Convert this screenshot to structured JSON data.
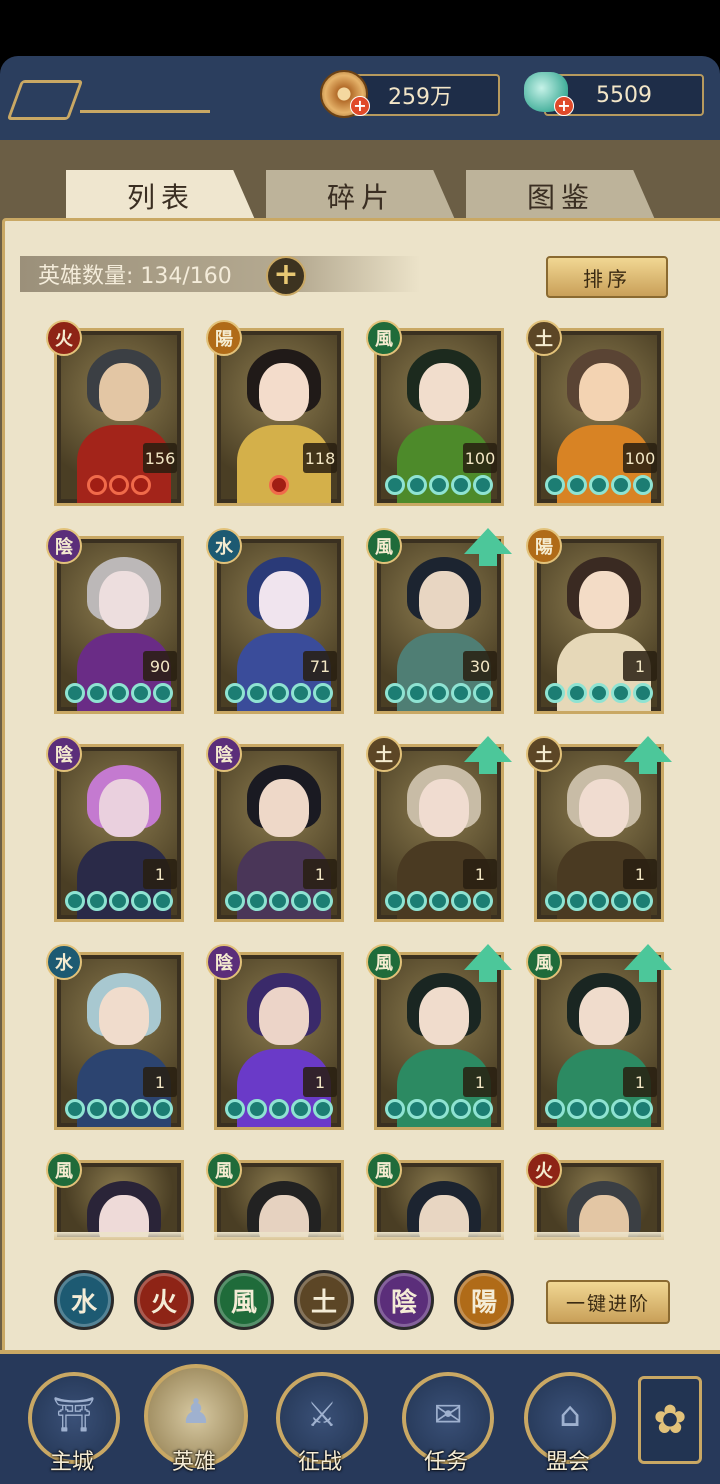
{
  "header": {
    "copper_amount": "259万",
    "jade_amount": "5509",
    "copper_icon": "copper-coin-icon",
    "jade_icon": "jade-pouch-icon"
  },
  "tabs": [
    {
      "label": "列表",
      "active": true
    },
    {
      "label": "碎片",
      "active": false
    },
    {
      "label": "图鉴",
      "active": false
    }
  ],
  "hero_count": "英雄数量: 134/160",
  "sort_label": "排序",
  "elements": {
    "fire": {
      "glyph": "火",
      "color": "#8e2416"
    },
    "yang": {
      "glyph": "陽",
      "color": "#b06b18"
    },
    "wind": {
      "glyph": "風",
      "color": "#1f6b3a"
    },
    "earth": {
      "glyph": "土",
      "color": "#5c4626"
    },
    "yin": {
      "glyph": "陰",
      "color": "#5b2e7a"
    },
    "water": {
      "glyph": "水",
      "color": "#1d5a72"
    }
  },
  "heroes": [
    {
      "element": "fire",
      "level": "156",
      "stars": 3,
      "star_color": "red",
      "upgrade": false,
      "art": [
        "#e3c6a4",
        "#3b3f44",
        "#a3241a"
      ]
    },
    {
      "element": "yang",
      "level": "118",
      "stars": 1,
      "star_color": "red",
      "upgrade": false,
      "art": [
        "#f3dccb",
        "#201a18",
        "#d4b04a"
      ]
    },
    {
      "element": "wind",
      "level": "100",
      "stars": 5,
      "star_color": "teal",
      "upgrade": false,
      "art": [
        "#f1ddcc",
        "#1c2a1e",
        "#4d8a2a"
      ]
    },
    {
      "element": "earth",
      "level": "100",
      "stars": 5,
      "star_color": "teal",
      "upgrade": false,
      "art": [
        "#f3d3b2",
        "#5a4434",
        "#d88324"
      ]
    },
    {
      "element": "yin",
      "level": "90",
      "stars": 5,
      "star_color": "teal",
      "upgrade": false,
      "art": [
        "#eddede",
        "#bcb8b8",
        "#6a2c86"
      ]
    },
    {
      "element": "water",
      "level": "71",
      "stars": 5,
      "star_color": "teal",
      "upgrade": false,
      "art": [
        "#f0e4ee",
        "#2a3a78",
        "#3a4c9a"
      ]
    },
    {
      "element": "wind",
      "level": "30",
      "stars": 5,
      "star_color": "teal",
      "upgrade": true,
      "art": [
        "#e8d6c2",
        "#1c2430",
        "#4f7e74"
      ]
    },
    {
      "element": "yang",
      "level": "1",
      "stars": 5,
      "star_color": "teal",
      "upgrade": false,
      "art": [
        "#f3dcc6",
        "#3a2a22",
        "#e6d8b8"
      ]
    },
    {
      "element": "yin",
      "level": "1",
      "stars": 5,
      "star_color": "teal",
      "upgrade": false,
      "art": [
        "#ead0de",
        "#c47ad0",
        "#2a2a48"
      ]
    },
    {
      "element": "yin",
      "level": "1",
      "stars": 5,
      "star_color": "teal",
      "upgrade": false,
      "art": [
        "#eed8c8",
        "#1a1a22",
        "#4a3658"
      ]
    },
    {
      "element": "earth",
      "level": "1",
      "stars": 5,
      "star_color": "teal",
      "upgrade": true,
      "art": [
        "#f0dcd0",
        "#c8bca6",
        "#4a3a22"
      ]
    },
    {
      "element": "earth",
      "level": "1",
      "stars": 5,
      "star_color": "teal",
      "upgrade": true,
      "art": [
        "#f0dcd0",
        "#c8bca6",
        "#4a3a22"
      ]
    },
    {
      "element": "water",
      "level": "1",
      "stars": 5,
      "star_color": "teal",
      "upgrade": false,
      "art": [
        "#f0dccc",
        "#a8c8d0",
        "#2c4470"
      ]
    },
    {
      "element": "yin",
      "level": "1",
      "stars": 5,
      "star_color": "teal",
      "upgrade": false,
      "art": [
        "#ecd4c8",
        "#3a2a6a",
        "#6a3ac8"
      ]
    },
    {
      "element": "wind",
      "level": "1",
      "stars": 5,
      "star_color": "teal",
      "upgrade": true,
      "art": [
        "#f0dccc",
        "#1a2622",
        "#2c8a62"
      ]
    },
    {
      "element": "wind",
      "level": "1",
      "stars": 5,
      "star_color": "teal",
      "upgrade": true,
      "art": [
        "#f0dccc",
        "#1a2622",
        "#2c8a62"
      ]
    },
    {
      "element": "wind",
      "level": "",
      "stars": 0,
      "star_color": "teal",
      "upgrade": false,
      "art": [
        "#eedad8",
        "#2a2438",
        "#8ac83c"
      ]
    },
    {
      "element": "wind",
      "level": "",
      "stars": 0,
      "star_color": "teal",
      "upgrade": false,
      "art": [
        "#e6d2c0",
        "#222",
        "#4a4a3a"
      ]
    },
    {
      "element": "wind",
      "level": "",
      "stars": 0,
      "star_color": "teal",
      "upgrade": false,
      "art": [
        "#e8d6c2",
        "#1c2430",
        "#4f7e74"
      ]
    },
    {
      "element": "fire",
      "level": "",
      "stars": 0,
      "star_color": "teal",
      "upgrade": false,
      "art": [
        "#e3c6a4",
        "#3b3f44",
        "#a3241a"
      ]
    }
  ],
  "filters": [
    "water",
    "fire",
    "wind",
    "earth",
    "yin",
    "yang"
  ],
  "advance_all_label": "一键进阶",
  "nav": [
    {
      "label": "主城",
      "icon": "city-gate-icon",
      "glyph": "⛩"
    },
    {
      "label": "英雄",
      "icon": "hero-portrait-icon",
      "glyph": "♟"
    },
    {
      "label": "征战",
      "icon": "battle-icon",
      "glyph": "⚔"
    },
    {
      "label": "任务",
      "icon": "task-scroll-icon",
      "glyph": "✉"
    },
    {
      "label": "盟会",
      "icon": "alliance-icon",
      "glyph": "⌂"
    }
  ],
  "nav_extra_icon": "flower-menu-icon"
}
